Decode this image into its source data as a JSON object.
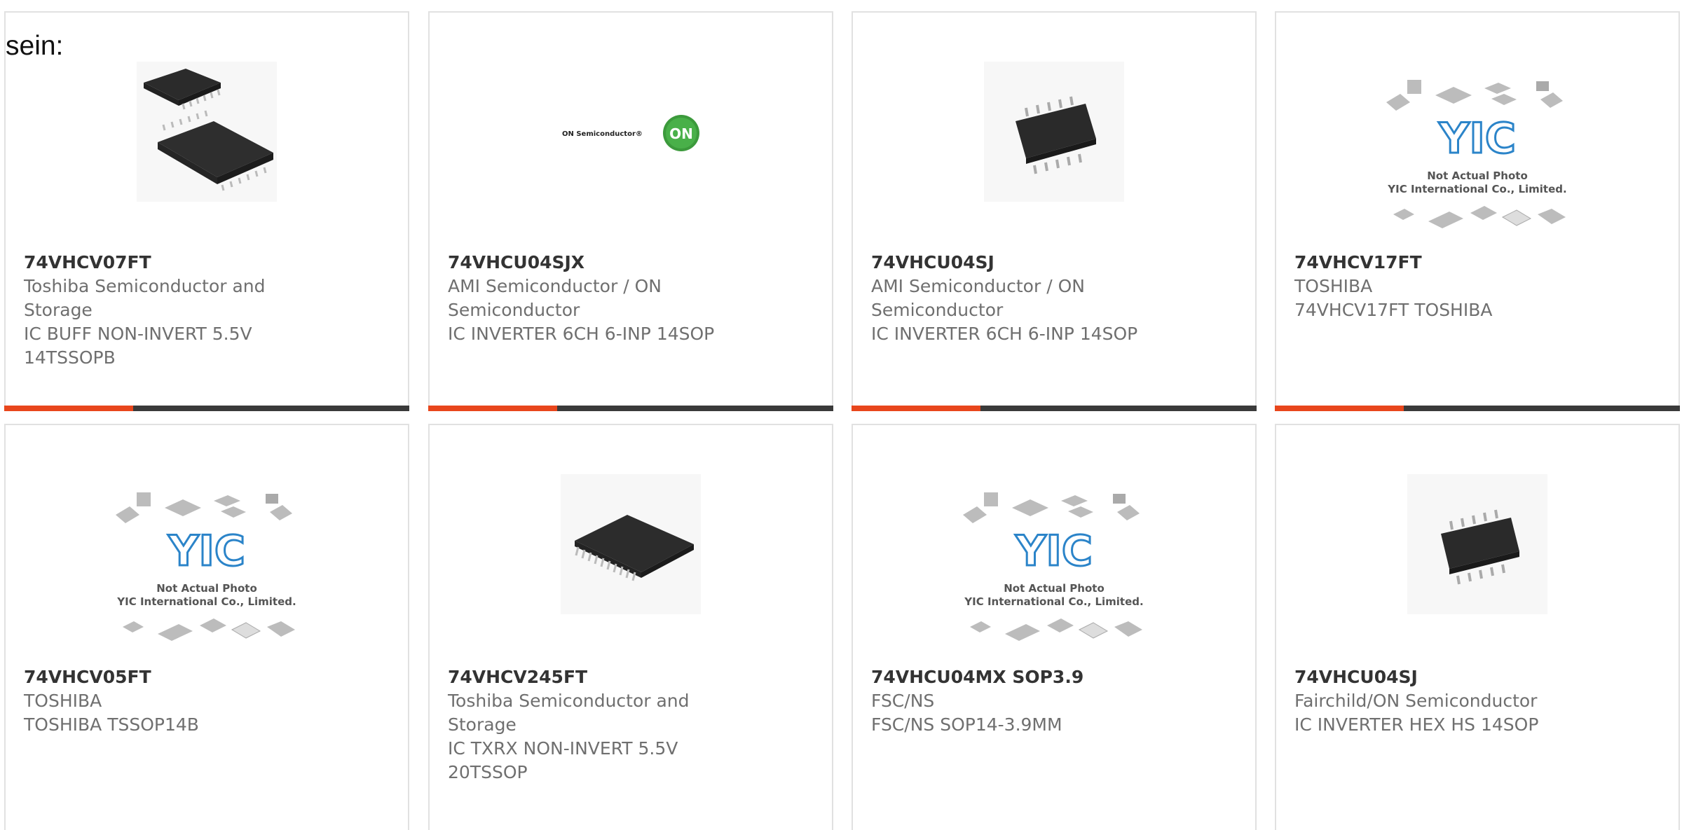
{
  "intro": {
    "text": "sein:"
  },
  "colors": {
    "accent": "#e8461c",
    "bar": "#3a3a3a",
    "border": "#e1e1e1",
    "part_number": "#333333",
    "text": "#6f6f6f"
  },
  "products": [
    {
      "part": "74VHCV07FT",
      "lines": [
        "Toshiba Semiconductor and",
        "Storage",
        "IC BUFF NON-INVERT 5.5V",
        "14TSSOPB"
      ],
      "image": "tssop-chip-pair"
    },
    {
      "part": "74VHCU04SJX",
      "lines": [
        "AMI Semiconductor / ON",
        "Semiconductor",
        "IC INVERTER 6CH 6-INP 14SOP"
      ],
      "image": "on-semiconductor-logo",
      "logo_text": "ON Semiconductor®",
      "logo_badge": "ON"
    },
    {
      "part": "74VHCU04SJ",
      "lines": [
        "AMI Semiconductor / ON",
        "Semiconductor",
        "IC INVERTER 6CH 6-INP 14SOP"
      ],
      "image": "soic-chip"
    },
    {
      "part": "74VHCV17FT",
      "lines": [
        "TOSHIBA",
        "74VHCV17FT TOSHIBA"
      ],
      "image": "yic-placeholder",
      "placeholder_logo": "YIC",
      "placeholder_line1": "Not Actual Photo",
      "placeholder_line2": "YIC International Co., Limited."
    },
    {
      "part": "74VHCV05FT",
      "lines": [
        "TOSHIBA",
        "TOSHIBA TSSOP14B"
      ],
      "image": "yic-placeholder",
      "placeholder_logo": "YIC",
      "placeholder_line1": "Not Actual Photo",
      "placeholder_line2": "YIC International Co., Limited."
    },
    {
      "part": "74VHCV245FT",
      "lines": [
        "Toshiba Semiconductor and",
        "Storage",
        "IC TXRX NON-INVERT 5.5V",
        "20TSSOP"
      ],
      "image": "tssop-20-chip"
    },
    {
      "part": "74VHCU04MX SOP3.9",
      "lines": [
        "FSC/NS",
        "FSC/NS SOP14-3.9MM"
      ],
      "image": "yic-placeholder",
      "placeholder_logo": "YIC",
      "placeholder_line1": "Not Actual Photo",
      "placeholder_line2": "YIC International Co., Limited."
    },
    {
      "part": "74VHCU04SJ",
      "lines": [
        "Fairchild/ON Semiconductor",
        "IC INVERTER HEX HS 14SOP"
      ],
      "image": "soic-chip"
    }
  ]
}
